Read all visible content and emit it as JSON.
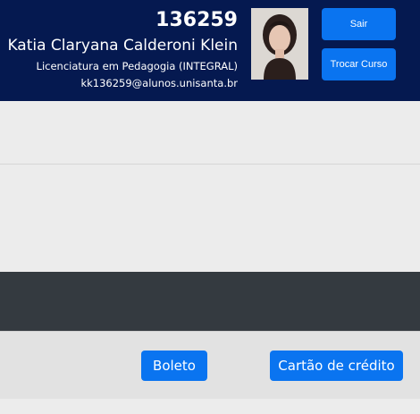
{
  "header": {
    "student_id": "136259",
    "student_name": "Katia Claryana Calderoni Klein",
    "course": "Licenciatura em Pedagogia (INTEGRAL)",
    "email": "kk136259@alunos.unisanta.br",
    "logout_label": "Sair",
    "switch_course_label": "Trocar Curso"
  },
  "payment": {
    "boleto_label": "Boleto",
    "card_label": "Cartão de crédito"
  },
  "colors": {
    "header_bg": "#051950",
    "button_blue": "#0a74f0",
    "dark_bar": "#343a40"
  }
}
